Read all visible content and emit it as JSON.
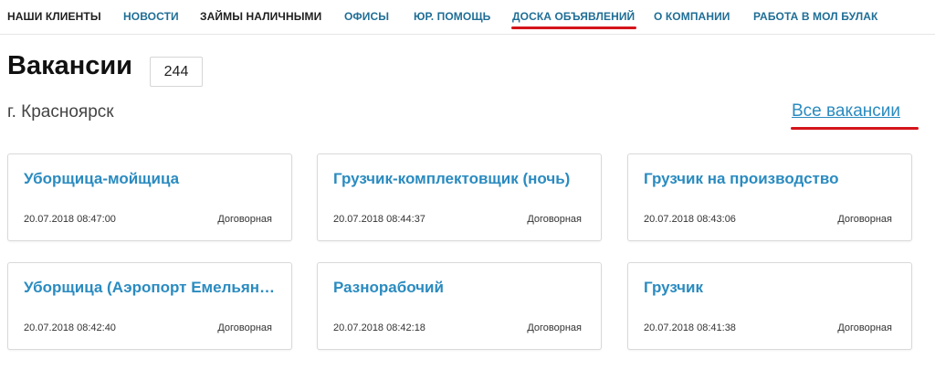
{
  "nav": {
    "items": [
      {
        "label": "НАШИ КЛИЕНТЫ"
      },
      {
        "label": "НОВОСТИ"
      },
      {
        "label": "ЗАЙМЫ НАЛИЧНЫМИ"
      },
      {
        "label": "ОФИСЫ"
      },
      {
        "label": "ЮР. ПОМОЩЬ"
      },
      {
        "label": "ДОСКА ОБЪЯВЛЕНИЙ"
      },
      {
        "label": "О КОМПАНИИ"
      },
      {
        "label": "РАБОТА В МОЛ БУЛАК"
      }
    ]
  },
  "page": {
    "title": "Вакансии",
    "count": "244",
    "city": "г. Красноярск",
    "all_link": "Все вакансии"
  },
  "vacancies": [
    {
      "title": "Уборщица-мойщица",
      "date": "20.07.2018 08:47:00",
      "salary": "Договорная"
    },
    {
      "title": "Грузчик-комплектовщик (ночь)",
      "date": "20.07.2018 08:44:37",
      "salary": "Договорная"
    },
    {
      "title": "Грузчик на производство",
      "date": "20.07.2018 08:43:06",
      "salary": "Договорная"
    },
    {
      "title": "Уборщица (Аэропорт Емельяново)",
      "date": "20.07.2018 08:42:40",
      "salary": "Договорная"
    },
    {
      "title": "Разнорабочий",
      "date": "20.07.2018 08:42:18",
      "salary": "Договорная"
    },
    {
      "title": "Грузчик",
      "date": "20.07.2018 08:41:38",
      "salary": "Договорная"
    }
  ],
  "colors": {
    "link": "#2a8bc0",
    "nav_blue": "#1f6e96",
    "highlight_underline": "#d4141b",
    "border": "#d9d9d9"
  }
}
